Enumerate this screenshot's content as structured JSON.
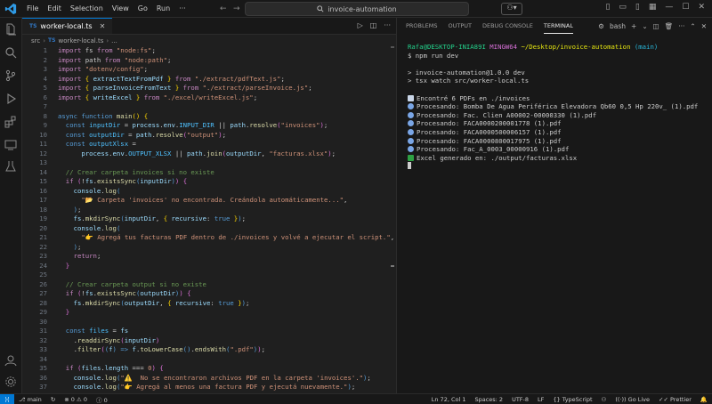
{
  "menus": [
    "File",
    "Edit",
    "Selection",
    "View",
    "Go",
    "Run"
  ],
  "search": {
    "text": "invoice-automation"
  },
  "editor": {
    "tab_label": "worker-local.ts",
    "tab_icon": "TS",
    "breadcrumb": [
      "src",
      "worker-local.ts",
      "..."
    ],
    "lines": [
      [
        [
          "k",
          "import"
        ],
        [
          "txt",
          " fs "
        ],
        [
          "k",
          "from"
        ],
        [
          "s",
          " \"node:fs\""
        ],
        [
          "txt",
          ";"
        ]
      ],
      [
        [
          "k",
          "import"
        ],
        [
          "txt",
          " path "
        ],
        [
          "k",
          "from"
        ],
        [
          "s",
          " \"node:path\""
        ],
        [
          "txt",
          ";"
        ]
      ],
      [
        [
          "k",
          "import"
        ],
        [
          "s",
          " \"dotenv/config\""
        ],
        [
          "txt",
          ";"
        ]
      ],
      [
        [
          "k",
          "import"
        ],
        [
          "txt",
          " "
        ],
        [
          "y",
          "{"
        ],
        [
          "v",
          " extractTextFromPdf "
        ],
        [
          "y",
          "}"
        ],
        [
          "k",
          " from"
        ],
        [
          "s",
          " \"./extract/pdfText.js\""
        ],
        [
          "txt",
          ";"
        ]
      ],
      [
        [
          "k",
          "import"
        ],
        [
          "txt",
          " "
        ],
        [
          "y",
          "{"
        ],
        [
          "v",
          " parseInvoiceFromText "
        ],
        [
          "y",
          "}"
        ],
        [
          "k",
          " from"
        ],
        [
          "s",
          " \"./extract/parseInvoice.js\""
        ],
        [
          "txt",
          ";"
        ]
      ],
      [
        [
          "k",
          "import"
        ],
        [
          "txt",
          " "
        ],
        [
          "y",
          "{"
        ],
        [
          "v",
          " writeExcel "
        ],
        [
          "y",
          "}"
        ],
        [
          "k",
          " from"
        ],
        [
          "s",
          " \"./excel/writeExcel.js\""
        ],
        [
          "txt",
          ";"
        ]
      ],
      [],
      [
        [
          "kb",
          "async"
        ],
        [
          "kb",
          " function"
        ],
        [
          "f",
          " main"
        ],
        [
          "y",
          "()"
        ],
        [
          "txt",
          " "
        ],
        [
          "y",
          "{"
        ]
      ],
      [
        [
          "txt",
          "  "
        ],
        [
          "kb",
          "const"
        ],
        [
          "cn",
          " inputDir"
        ],
        [
          "txt",
          " = "
        ],
        [
          "v",
          "process"
        ],
        [
          "txt",
          "."
        ],
        [
          "v",
          "env"
        ],
        [
          "txt",
          "."
        ],
        [
          "cn",
          "INPUT_DIR"
        ],
        [
          "txt",
          " || "
        ],
        [
          "v",
          "path"
        ],
        [
          "txt",
          "."
        ],
        [
          "f",
          "resolve"
        ],
        [
          "p",
          "("
        ],
        [
          "s",
          "\"invoices\""
        ],
        [
          "p",
          ")"
        ],
        [
          "txt",
          ";"
        ]
      ],
      [
        [
          "txt",
          "  "
        ],
        [
          "kb",
          "const"
        ],
        [
          "cn",
          " outputDir"
        ],
        [
          "txt",
          " = "
        ],
        [
          "v",
          "path"
        ],
        [
          "txt",
          "."
        ],
        [
          "f",
          "resolve"
        ],
        [
          "p",
          "("
        ],
        [
          "s",
          "\"output\""
        ],
        [
          "p",
          ")"
        ],
        [
          "txt",
          ";"
        ]
      ],
      [
        [
          "txt",
          "  "
        ],
        [
          "kb",
          "const"
        ],
        [
          "cn",
          " outputXlsx"
        ],
        [
          "txt",
          " ="
        ]
      ],
      [
        [
          "txt",
          "      "
        ],
        [
          "v",
          "process"
        ],
        [
          "txt",
          "."
        ],
        [
          "v",
          "env"
        ],
        [
          "txt",
          "."
        ],
        [
          "cn",
          "OUTPUT_XLSX"
        ],
        [
          "txt",
          " || "
        ],
        [
          "v",
          "path"
        ],
        [
          "txt",
          "."
        ],
        [
          "f",
          "join"
        ],
        [
          "p",
          "("
        ],
        [
          "v",
          "outputDir"
        ],
        [
          "txt",
          ", "
        ],
        [
          "s",
          "\"facturas.xlsx\""
        ],
        [
          "p",
          ")"
        ],
        [
          "txt",
          ";"
        ]
      ],
      [],
      [
        [
          "c",
          "  // Crear carpeta invoices si no existe"
        ]
      ],
      [
        [
          "txt",
          "  "
        ],
        [
          "k",
          "if"
        ],
        [
          "txt",
          " "
        ],
        [
          "p",
          "("
        ],
        [
          "txt",
          "!"
        ],
        [
          "v",
          "fs"
        ],
        [
          "txt",
          "."
        ],
        [
          "f",
          "existsSync"
        ],
        [
          "kb",
          "("
        ],
        [
          "v",
          "inputDir"
        ],
        [
          "kb",
          ")"
        ],
        [
          "p",
          ")"
        ],
        [
          "txt",
          " "
        ],
        [
          "p",
          "{"
        ]
      ],
      [
        [
          "txt",
          "    "
        ],
        [
          "v",
          "console"
        ],
        [
          "txt",
          "."
        ],
        [
          "f",
          "log"
        ],
        [
          "kb",
          "("
        ]
      ],
      [
        [
          "s",
          "      \"📂 Carpeta 'invoices' no encontrada. Creándola automáticamente...\""
        ],
        [
          "txt",
          ","
        ]
      ],
      [
        [
          "txt",
          "    "
        ],
        [
          "kb",
          ")"
        ],
        [
          "txt",
          ";"
        ]
      ],
      [
        [
          "txt",
          "    "
        ],
        [
          "v",
          "fs"
        ],
        [
          "txt",
          "."
        ],
        [
          "f",
          "mkdirSync"
        ],
        [
          "kb",
          "("
        ],
        [
          "v",
          "inputDir"
        ],
        [
          "txt",
          ", "
        ],
        [
          "y",
          "{"
        ],
        [
          "v",
          " recursive"
        ],
        [
          "txt",
          ": "
        ],
        [
          "kb",
          "true"
        ],
        [
          "y",
          " }"
        ],
        [
          "kb",
          ")"
        ],
        [
          "txt",
          ";"
        ]
      ],
      [
        [
          "txt",
          "    "
        ],
        [
          "v",
          "console"
        ],
        [
          "txt",
          "."
        ],
        [
          "f",
          "log"
        ],
        [
          "kb",
          "("
        ]
      ],
      [
        [
          "s",
          "      \"👉 Agregá tus facturas PDF dentro de ./invoices y volvé a ejecutar el script.\""
        ],
        [
          "txt",
          ","
        ]
      ],
      [
        [
          "txt",
          "    "
        ],
        [
          "kb",
          ")"
        ],
        [
          "txt",
          ";"
        ]
      ],
      [
        [
          "txt",
          "    "
        ],
        [
          "k",
          "return"
        ],
        [
          "txt",
          ";"
        ]
      ],
      [
        [
          "txt",
          "  "
        ],
        [
          "p",
          "}"
        ]
      ],
      [],
      [
        [
          "c",
          "  // Crear carpeta output si no existe"
        ]
      ],
      [
        [
          "txt",
          "  "
        ],
        [
          "k",
          "if"
        ],
        [
          "txt",
          " "
        ],
        [
          "p",
          "("
        ],
        [
          "txt",
          "!"
        ],
        [
          "v",
          "fs"
        ],
        [
          "txt",
          "."
        ],
        [
          "f",
          "existsSync"
        ],
        [
          "kb",
          "("
        ],
        [
          "v",
          "outputDir"
        ],
        [
          "kb",
          ")"
        ],
        [
          "p",
          ")"
        ],
        [
          "txt",
          " "
        ],
        [
          "p",
          "{"
        ]
      ],
      [
        [
          "txt",
          "    "
        ],
        [
          "v",
          "fs"
        ],
        [
          "txt",
          "."
        ],
        [
          "f",
          "mkdirSync"
        ],
        [
          "kb",
          "("
        ],
        [
          "v",
          "outputDir"
        ],
        [
          "txt",
          ", "
        ],
        [
          "y",
          "{"
        ],
        [
          "v",
          " recursive"
        ],
        [
          "txt",
          ": "
        ],
        [
          "kb",
          "true"
        ],
        [
          "y",
          " }"
        ],
        [
          "kb",
          ")"
        ],
        [
          "txt",
          ";"
        ]
      ],
      [
        [
          "txt",
          "  "
        ],
        [
          "p",
          "}"
        ]
      ],
      [],
      [
        [
          "txt",
          "  "
        ],
        [
          "kb",
          "const"
        ],
        [
          "cn",
          " files"
        ],
        [
          "txt",
          " = "
        ],
        [
          "v",
          "fs"
        ]
      ],
      [
        [
          "txt",
          "    ."
        ],
        [
          "f",
          "readdirSync"
        ],
        [
          "p",
          "("
        ],
        [
          "v",
          "inputDir"
        ],
        [
          "p",
          ")"
        ]
      ],
      [
        [
          "txt",
          "    ."
        ],
        [
          "f",
          "filter"
        ],
        [
          "p",
          "("
        ],
        [
          "kb",
          "("
        ],
        [
          "v",
          "f"
        ],
        [
          "kb",
          ")"
        ],
        [
          "kb",
          " =>"
        ],
        [
          "v",
          " f"
        ],
        [
          "txt",
          "."
        ],
        [
          "f",
          "toLowerCase"
        ],
        [
          "kb",
          "()"
        ],
        [
          "txt",
          "."
        ],
        [
          "f",
          "endsWith"
        ],
        [
          "kb",
          "("
        ],
        [
          "s",
          "\".pdf\""
        ],
        [
          "kb",
          ")"
        ],
        [
          "p",
          ")"
        ],
        [
          "txt",
          ";"
        ]
      ],
      [],
      [
        [
          "txt",
          "  "
        ],
        [
          "k",
          "if"
        ],
        [
          "txt",
          " "
        ],
        [
          "p",
          "("
        ],
        [
          "v",
          "files"
        ],
        [
          "txt",
          "."
        ],
        [
          "v",
          "length"
        ],
        [
          "txt",
          " === "
        ],
        [
          "s",
          "0"
        ],
        [
          "p",
          ")"
        ],
        [
          "txt",
          " "
        ],
        [
          "p",
          "{"
        ]
      ],
      [
        [
          "txt",
          "    "
        ],
        [
          "v",
          "console"
        ],
        [
          "txt",
          "."
        ],
        [
          "f",
          "log"
        ],
        [
          "kb",
          "("
        ],
        [
          "s",
          "\"⚠️  No se encontraron archivos PDF en la carpeta 'invoices'.\""
        ],
        [
          "kb",
          ")"
        ],
        [
          "txt",
          ";"
        ]
      ],
      [
        [
          "txt",
          "    "
        ],
        [
          "v",
          "console"
        ],
        [
          "txt",
          "."
        ],
        [
          "f",
          "log"
        ],
        [
          "kb",
          "("
        ],
        [
          "s",
          "\"👉 Agregá al menos una factura PDF y ejecutá nuevamente.\""
        ],
        [
          "kb",
          ")"
        ],
        [
          "txt",
          ";"
        ]
      ]
    ]
  },
  "panel": {
    "tabs": [
      "PROBLEMS",
      "OUTPUT",
      "DEBUG CONSOLE",
      "TERMINAL"
    ],
    "active_tab": "TERMINAL",
    "shell": "bash"
  },
  "terminal": {
    "prompt_user": "Rafa@DESKTOP-INIA89I",
    "prompt_env": "MINGW64",
    "prompt_path": "~/Desktop/invoice-automation",
    "prompt_branch": "(main)",
    "command": "$ npm run dev",
    "out1": "> invoice-automation@1.0.0 dev",
    "out2": "> tsx watch src/worker-local.ts",
    "found": "Encontré 6 PDFs en ./invoices",
    "processing": [
      "Procesando: Bomba De Agua Periférica Elevadora Qb60 0,5 Hp 220v_ (1).pdf",
      "Procesando: Fac. Clien A00002-00000330 (1).pdf",
      "Procesando: FACA0000200001778 (1).pdf",
      "Procesando: FACA0000500006157 (1).pdf",
      "Procesando: FACA0000800017975 (1).pdf",
      "Procesando: Fac_A_0003_00000916 (1).pdf"
    ],
    "done": "Excel generado en: ./output/facturas.xlsx"
  },
  "status": {
    "branch": "main",
    "errors": "0",
    "warnings": "0",
    "info": "0",
    "position": "Ln 72, Col 1",
    "spaces": "Spaces: 2",
    "encoding": "UTF-8",
    "eol": "LF",
    "language": "TypeScript",
    "golive": "Go Live",
    "prettier": "Prettier"
  }
}
